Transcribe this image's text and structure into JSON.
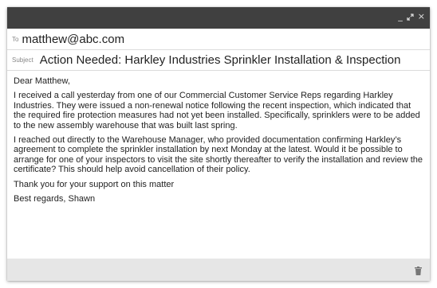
{
  "window": {
    "controls": [
      "minimize-icon",
      "expand-icon",
      "close-icon"
    ],
    "minimize_glyph": "_",
    "close_glyph": "×"
  },
  "to": {
    "label": "To",
    "value": "matthew@abc.com"
  },
  "subject": {
    "label": "Subject",
    "value": "Action Needed: Harkley Industries Sprinkler Installation & Inspection"
  },
  "body": {
    "greeting": "Dear Matthew,",
    "paragraph1": "I received a call yesterday from one of our Commercial Customer Service Reps regarding Harkley Industries. They were issued a non-renewal notice following the recent inspection, which indicated that the required fire protection measures had not yet been installed. Specifically, sprinklers were to be added to the new assembly warehouse that was built last spring.",
    "paragraph2": "I reached out directly to the Warehouse Manager, who provided documentation confirming Harkley’s agreement to complete the sprinkler installation by next Monday at the latest. Would it be possible to arrange for one of your inspectors to visit the site shortly thereafter to verify the installation and review the certificate? This should help avoid cancellation of their policy.",
    "thanks": "Thank you for your support on this matter",
    "signoff": "Best regards, Shawn"
  },
  "footer": {
    "icon": "trash-icon"
  },
  "colors": {
    "titlebar": "#404040",
    "footer": "#e6e6e6",
    "text": "#222222",
    "label": "#888888"
  }
}
